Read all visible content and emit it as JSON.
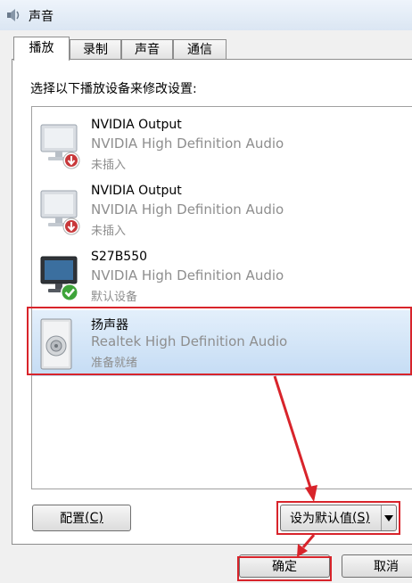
{
  "window": {
    "title": "声音",
    "icon": "speaker-icon"
  },
  "tabs": [
    {
      "label": "播放",
      "active": true
    },
    {
      "label": "录制",
      "active": false
    },
    {
      "label": "声音",
      "active": false
    },
    {
      "label": "通信",
      "active": false
    }
  ],
  "instruction": "选择以下播放设备来修改设置:",
  "devices": [
    {
      "name": "NVIDIA Output",
      "driver": "NVIDIA High Definition Audio",
      "status": "未插入",
      "icon": "monitor-icon",
      "badge": "unplugged-badge-icon",
      "selected": false
    },
    {
      "name": "NVIDIA Output",
      "driver": "NVIDIA High Definition Audio",
      "status": "未插入",
      "icon": "monitor-icon",
      "badge": "unplugged-badge-icon",
      "selected": false
    },
    {
      "name": "S27B550",
      "driver": "NVIDIA High Definition Audio",
      "status": "默认设备",
      "icon": "monitor-icon",
      "badge": "default-check-icon",
      "selected": false
    },
    {
      "name": "扬声器",
      "driver": "Realtek High Definition Audio",
      "status": "准备就绪",
      "icon": "speaker-device-icon",
      "badge": "",
      "selected": true
    }
  ],
  "buttons": {
    "configure": {
      "label": "配置",
      "accel": "(C)"
    },
    "set_default": {
      "label": "设为默认值",
      "accel": "(S)"
    },
    "ok": {
      "label": "确定"
    },
    "cancel": {
      "label": "取消"
    }
  },
  "colors": {
    "annotation_red": "#d8242b",
    "selection_top": "#e3effb",
    "selection_bottom": "#c5dcf4",
    "secondary_text": "#8e8e8e"
  }
}
